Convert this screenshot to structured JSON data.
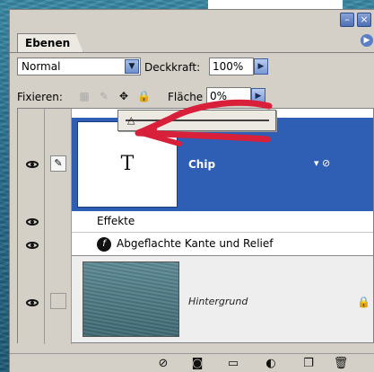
{
  "palette": {
    "tab_label": "Ebenen",
    "blend_mode": "Normal",
    "opacity_label": "Deckkraft:",
    "opacity_value": "100%",
    "lock_label": "Fixieren:",
    "fill_label": "Fläche",
    "fill_value": "0%"
  },
  "layers": {
    "text_layer": {
      "thumb": "T",
      "name": "Chip"
    },
    "effects_label": "Effekte",
    "bevel_label": "Abgeflachte Kante und Relief",
    "background_name": "Hintergrund"
  },
  "colors": {
    "selected_row": "#2f5fb4",
    "annotation": "#d8203a"
  }
}
